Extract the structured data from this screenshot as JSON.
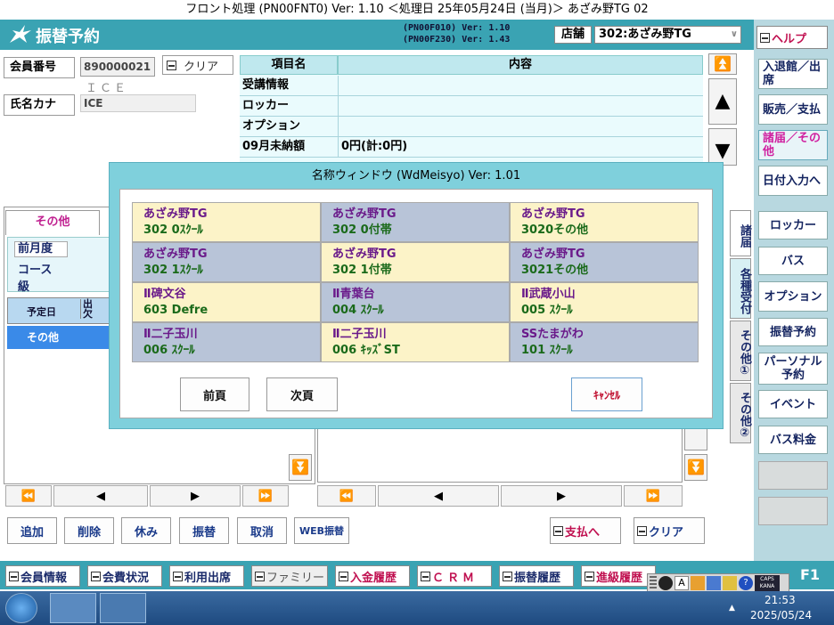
{
  "title_bar": "フロント処理 (PN00FNT0) Ver: 1.10 ＜処理日 25年05月24日 (当月)＞ あざみ野TG 02",
  "header": {
    "title": "振替予約",
    "ver1": "(PN00F010)  Ver: 1.10",
    "ver2": "(PN00F230)  Ver: 1.43",
    "store_label": "店舗",
    "store_value": "302:あざみ野TG",
    "help": "ヘルプ"
  },
  "member": {
    "no_label": "会員番号",
    "no_value": "890000021",
    "clear": "クリア",
    "name_sub": "ＩＣＥ",
    "kana_label": "氏名カナ",
    "kana_value": "ICE"
  },
  "info_table": {
    "col1": "項目名",
    "col2": "内容",
    "rows": [
      {
        "k": "受講情報",
        "v": ""
      },
      {
        "k": "ロッカー",
        "v": ""
      },
      {
        "k": "オプション",
        "v": ""
      },
      {
        "k": "09月未納額",
        "v": "0円(計:0円)"
      }
    ]
  },
  "left_panel": {
    "tab": "その他",
    "prev": "前月度",
    "course": "コース",
    "grade": "級",
    "col_date": "予定日",
    "col_att": "出欠",
    "row_sel": "その他"
  },
  "right_menu": {
    "nyutai": "入退館／出席",
    "hanbai": "販売／支払",
    "shotodoke": "諸届／その他",
    "hizuke": "日付入力へ",
    "locker": "ロッカー",
    "bus": "バス",
    "option": "オプション",
    "furikae": "振替予約",
    "personal": "パーソナル予約",
    "event": "イベント",
    "bus_fee": "バス料金"
  },
  "vtabs": {
    "t1": "諸届",
    "t2": "各種受付",
    "t3": "その他①",
    "t4": "その他②"
  },
  "action_buttons": {
    "add": "追加",
    "del": "削除",
    "rest": "休み",
    "transfer": "振替",
    "cancel": "取消",
    "web": "WEB振替",
    "pay": "支払へ",
    "clear": "クリア"
  },
  "bottom_tabs": [
    "会員情報",
    "会費状況",
    "利用出席",
    "ファミリー",
    "入金履歴",
    "ＣＲＭ",
    "振替履歴",
    "進級履歴"
  ],
  "f1": "F1",
  "dialog": {
    "title": "名称ウィンドウ (WdMeisyo) Ver: 1.01",
    "cells": [
      {
        "a": "あざみ野TG",
        "b": "302 0ｽｸｰﾙ",
        "bg": "#fcf3c8"
      },
      {
        "a": "あざみ野TG",
        "b": "302 0付帯",
        "bg": "#b8c4d8"
      },
      {
        "a": "あざみ野TG",
        "b": "3020その他",
        "bg": "#fcf3c8"
      },
      {
        "a": "あざみ野TG",
        "b": "302 1ｽｸｰﾙ",
        "bg": "#b8c4d8"
      },
      {
        "a": "あざみ野TG",
        "b": "302 1付帯",
        "bg": "#fcf3c8"
      },
      {
        "a": "あざみ野TG",
        "b": "3021その他",
        "bg": "#b8c4d8"
      },
      {
        "a": "Ⅱ碑文谷",
        "b": "603 Defre",
        "bg": "#fcf3c8"
      },
      {
        "a": "Ⅱ青葉台",
        "b": "004 ｽｸｰﾙ",
        "bg": "#b8c4d8"
      },
      {
        "a": "Ⅱ武蔵小山",
        "b": "005 ｽｸｰﾙ",
        "bg": "#fcf3c8"
      },
      {
        "a": "Ⅱ二子玉川",
        "b": "006 ｽｸｰﾙ",
        "bg": "#b8c4d8"
      },
      {
        "a": "Ⅱ二子玉川",
        "b": "006 ｷｯｽﾞST",
        "bg": "#fcf3c8"
      },
      {
        "a": "SSたまがわ",
        "b": "101 ｽｸｰﾙ",
        "bg": "#b8c4d8"
      }
    ],
    "prev": "前頁",
    "next": "次頁",
    "cancel": "ｷｬﾝｾﾙ"
  },
  "taskbar": {
    "time": "21:53",
    "date": "2025/05/24",
    "caps": "CAPS",
    "kana": "KANA"
  }
}
